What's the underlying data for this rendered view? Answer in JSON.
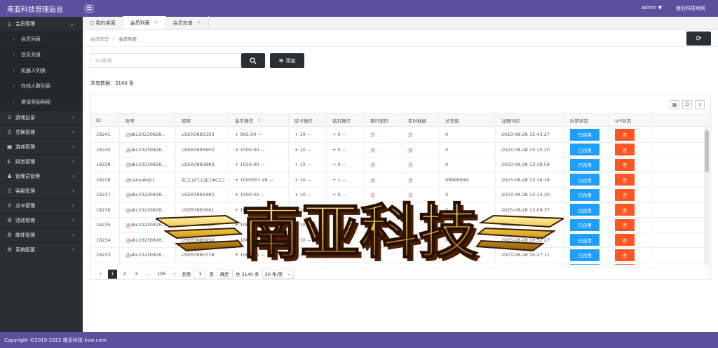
{
  "app": {
    "title": "南亚科技管理后台",
    "menu_icon": "hamburger-icon"
  },
  "header": {
    "user": "admin",
    "user_caret": "▼",
    "site_link": "南亚科技官网"
  },
  "sidebar": {
    "groups": [
      {
        "label": "会员管理",
        "icon": "user-icon",
        "expanded": true,
        "items": [
          "会员列表",
          "会员充值",
          "机器人列表",
          "在线人数列表",
          "邀请奖励明细"
        ]
      },
      {
        "label": "游戏记录",
        "icon": "user-icon"
      },
      {
        "label": "兑换管理",
        "icon": "user-icon"
      },
      {
        "label": "游戏管理",
        "icon": "gamepad-icon"
      },
      {
        "label": "财务管理",
        "icon": "dollar-icon"
      },
      {
        "label": "管理员管理",
        "icon": "admin-icon"
      },
      {
        "label": "客服管理",
        "icon": "user-icon"
      },
      {
        "label": "点卡管理",
        "icon": "user-icon"
      },
      {
        "label": "活动管理",
        "icon": "gear-icon"
      },
      {
        "label": "邮件管理",
        "icon": "gear-icon"
      },
      {
        "label": "系统配置",
        "icon": "gear-icon"
      }
    ]
  },
  "tabs": [
    {
      "label": "我的桌面",
      "icon": "home-icon",
      "closable": false
    },
    {
      "label": "会员列表",
      "closable": true,
      "active": true
    },
    {
      "label": "会员充值",
      "closable": true
    }
  ],
  "breadcrumb": {
    "items": [
      "会员管理",
      "会员列表"
    ],
    "sep": "/"
  },
  "search": {
    "placeholder": "ID/账号",
    "value": ""
  },
  "add_label": "添加",
  "total": "共有数据：3140 条",
  "table": {
    "columns": [
      "ID",
      "账号",
      "昵称",
      "金币操作",
      "房卡操作",
      "钻石操作",
      "银行密码",
      "实时数据",
      "总充值",
      "注册时间",
      "封禁状态",
      "VIP状态"
    ],
    "sort_mark": "⇕",
    "rows": [
      {
        "id": "18241",
        "flag": "消",
        "account": "abc20230828...",
        "nick": "USER3885303",
        "gold": "+ 995.50 —",
        "card": "+ 10 —",
        "diamond": "+ 0 —",
        "bank": "消",
        "realtime": "消",
        "recharge": "0",
        "reg": "2023-08-28 15:43:27",
        "ban": "已启用",
        "vip": "否"
      },
      {
        "id": "18240",
        "flag": "消",
        "account": "abc20230828...",
        "nick": "USER3885602",
        "gold": "+ 1000.00 —",
        "card": "+ 10 —",
        "diamond": "+ 0 —",
        "bank": "消",
        "realtime": "消",
        "recharge": "0",
        "reg": "2023-08-28 15:15:20",
        "ban": "已启用",
        "vip": "否"
      },
      {
        "id": "18239",
        "flag": "消",
        "account": "abc20230828...",
        "nick": "USER3883883",
        "gold": "+ 1026.00 —",
        "card": "+ 10 —",
        "diamond": "+ 0 —",
        "bank": "消",
        "realtime": "消",
        "recharge": "0",
        "reg": "2023-08-28 13:38:58",
        "ban": "已启用",
        "vip": "否"
      },
      {
        "id": "18238",
        "flag": "消",
        "account": "nanyakeji1",
        "nick": "å□□ä°□ç§□æ□□",
        "gold": "+ 1000957.49 —",
        "card": "+ 10 —",
        "diamond": "+ 1 —",
        "bank": "消",
        "realtime": "消",
        "recharge": "99999999",
        "reg": "2023-08-28 13:16:16",
        "ban": "已启用",
        "vip": "否"
      },
      {
        "id": "18237",
        "flag": "消",
        "account": "abc20230828...",
        "nick": "USER3883482",
        "gold": "+ 1000.00 —",
        "card": "+ 10 —",
        "diamond": "+ 0 —",
        "bank": "消",
        "realtime": "消",
        "recharge": "0",
        "reg": "2023-08-28 13:14:30",
        "ban": "已启用",
        "vip": "否"
      },
      {
        "id": "18236",
        "flag": "消",
        "account": "abc20230828...",
        "nick": "USER3883661",
        "gold": "+ 1000.00 —",
        "card": "+ 10 —",
        "diamond": "+ 0 —",
        "bank": "消",
        "realtime": "消",
        "recharge": "0",
        "reg": "2023-08-28 13:09:37",
        "ban": "已启用",
        "vip": "否"
      },
      {
        "id": "18235",
        "flag": "消",
        "account": "abc20230828...",
        "nick": "USER3883120",
        "gold": "+ 1000.00 —",
        "card": "+ 10 —",
        "diamond": "+ 0 —",
        "bank": "消",
        "realtime": "消",
        "recharge": "0",
        "reg": "2023-08-28 11:02:48",
        "ban": "已启用",
        "vip": "否"
      },
      {
        "id": "18234",
        "flag": "消",
        "account": "abc20230828...",
        "nick": "USER3880950",
        "gold": "+ 1000.00 —",
        "card": "+ 10 —",
        "diamond": "+ 0 —",
        "bank": "消",
        "realtime": "消",
        "recharge": "0",
        "reg": "2023-08-28 10:52:27",
        "ban": "已启用",
        "vip": "否"
      },
      {
        "id": "18233",
        "flag": "消",
        "account": "abc20230828...",
        "nick": "USER3880778",
        "gold": "+ 1000.00 —",
        "card": "+ 10 —",
        "diamond": "+ 0 —",
        "bank": "消",
        "realtime": "消",
        "recharge": "0",
        "reg": "2023-08-28 10:27:11",
        "ban": "已启用",
        "vip": "否"
      },
      {
        "id": "18232",
        "flag": "消",
        "account": "abc20230828...",
        "nick": "USER3880657",
        "gold": "+ 1000.00 —",
        "card": "+ 10 —",
        "diamond": "+ 0 —",
        "bank": "消",
        "realtime": "消",
        "recharge": "0",
        "reg": "2023-08-28 10:13:44",
        "ban": "已启用",
        "vip": "否"
      }
    ]
  },
  "pagination": {
    "prev": "‹",
    "pages": [
      "1",
      "2",
      "3",
      "…",
      "105"
    ],
    "next": "›",
    "goto_label": "到第",
    "goto_value": "1",
    "page_unit": "页",
    "confirm": "确定",
    "total": "共 3140 条",
    "per_page": "30 条/页"
  },
  "watermark": {
    "text": "南亚科技"
  },
  "footer": {
    "copyright": "Copyright ©2019-2022 南亚科技-kvsr.com"
  },
  "colors": {
    "header": "#5b4f9e",
    "sidebar": "#2a2f33",
    "enabled_btn": "#1e9fff",
    "vip_btn": "#ff5722"
  }
}
